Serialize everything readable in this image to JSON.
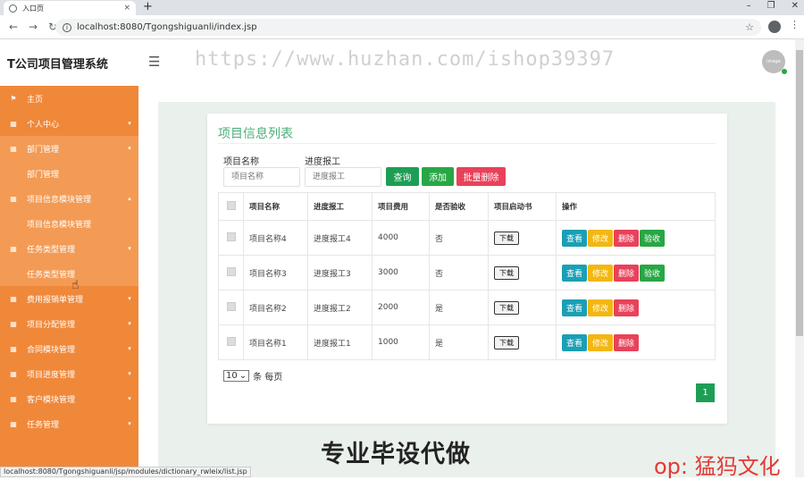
{
  "browser": {
    "tab_title": "入口页",
    "tab_close": "×",
    "new_tab": "+",
    "url": "localhost:8080/Tgongshiguanli/index.jsp",
    "status_url": "localhost:8080/Tgongshiguanli/jsp/modules/dictionary_rwleix/list.jsp"
  },
  "header": {
    "brand": "T公司项目管理系统",
    "watermark": "https://www.huzhan.com/ishop39397",
    "avatar_text": "image"
  },
  "sidebar": {
    "items": [
      {
        "label": "主页",
        "icon": "flag-icon"
      },
      {
        "label": "个人中心"
      },
      {
        "label": "部门管理"
      },
      {
        "label": "部门管理"
      },
      {
        "label": "项目信息模块管理"
      },
      {
        "label": "项目信息模块管理"
      },
      {
        "label": "任务类型管理"
      },
      {
        "label": "任务类型管理"
      },
      {
        "label": "费用报销单管理"
      },
      {
        "label": "项目分配管理"
      },
      {
        "label": "合同模块管理"
      },
      {
        "label": "项目进度管理"
      },
      {
        "label": "客户模块管理"
      },
      {
        "label": "任务管理"
      }
    ]
  },
  "main": {
    "title": "项目信息列表",
    "filters": {
      "name_label": "项目名称",
      "name_placeholder": "项目名称",
      "progress_label": "进度报工",
      "progress_placeholder": "进度报工"
    },
    "buttons": {
      "search": "查询",
      "add": "添加",
      "batch_delete": "批量删除"
    },
    "table": {
      "headers": [
        "项目名称",
        "进度报工",
        "项目费用",
        "是否验收",
        "项目启动书",
        "操作"
      ],
      "rows": [
        {
          "name": "项目名称4",
          "progress": "进度报工4",
          "cost": "4000",
          "accepted": "否",
          "download": "下载",
          "has_check": true
        },
        {
          "name": "项目名称3",
          "progress": "进度报工3",
          "cost": "3000",
          "accepted": "否",
          "download": "下载",
          "has_check": true
        },
        {
          "name": "项目名称2",
          "progress": "进度报工2",
          "cost": "2000",
          "accepted": "是",
          "download": "下载",
          "has_check": false
        },
        {
          "name": "项目名称1",
          "progress": "进度报工1",
          "cost": "1000",
          "accepted": "是",
          "download": "下载",
          "has_check": false
        }
      ],
      "ops": {
        "view": "查看",
        "edit": "修改",
        "delete": "删除",
        "check": "验收"
      }
    },
    "pager": {
      "page_size": "10",
      "suffix": "条 每页",
      "current_page": "1"
    }
  },
  "overlay": {
    "promo": "专业毕设代做",
    "contact": "op: 猛犸文化"
  }
}
